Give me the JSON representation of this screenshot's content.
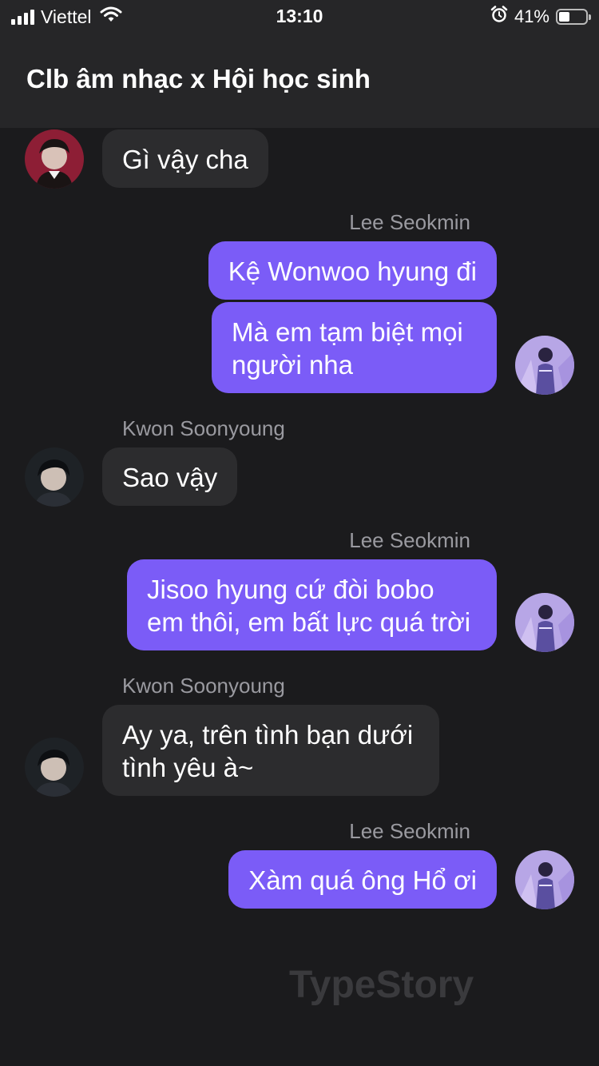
{
  "status_bar": {
    "carrier": "Viettel",
    "time": "13:10",
    "battery_percent": "41%",
    "battery_level": 0.41
  },
  "header": {
    "title": "Clb âm nhạc x Hội học sinh"
  },
  "messages": [
    {
      "direction": "in",
      "text": "Gì vậy cha",
      "avatar": "red-portrait-avatar"
    },
    {
      "direction": "out",
      "sender": "Lee Seokmin",
      "text": "Kệ Wonwoo hyung đi"
    },
    {
      "direction": "out",
      "text": "Mà em tạm biệt mọi người nha",
      "avatar": "purple-stage-avatar"
    },
    {
      "direction": "in",
      "sender": "Kwon Soonyoung",
      "text": "Sao vậy",
      "avatar": "dark-portrait-avatar"
    },
    {
      "direction": "out",
      "sender": "Lee Seokmin",
      "text": "Jisoo hyung cứ đòi bobo em thôi, em bất lực quá trời",
      "avatar": "purple-stage-avatar"
    },
    {
      "direction": "in",
      "sender": "Kwon Soonyoung",
      "text": "Ay ya, trên tình bạn dưới tình yêu à~",
      "avatar": "dark-portrait-avatar"
    },
    {
      "direction": "out",
      "sender": "Lee Seokmin",
      "text": "Xàm quá ông Hổ ơi",
      "avatar": "purple-stage-avatar"
    }
  ],
  "watermark": "TypeStory",
  "colors": {
    "outgoing_bubble": "#7b5cf7",
    "incoming_bubble": "#2c2c2e",
    "background": "#1b1b1d",
    "header": "#262628"
  }
}
